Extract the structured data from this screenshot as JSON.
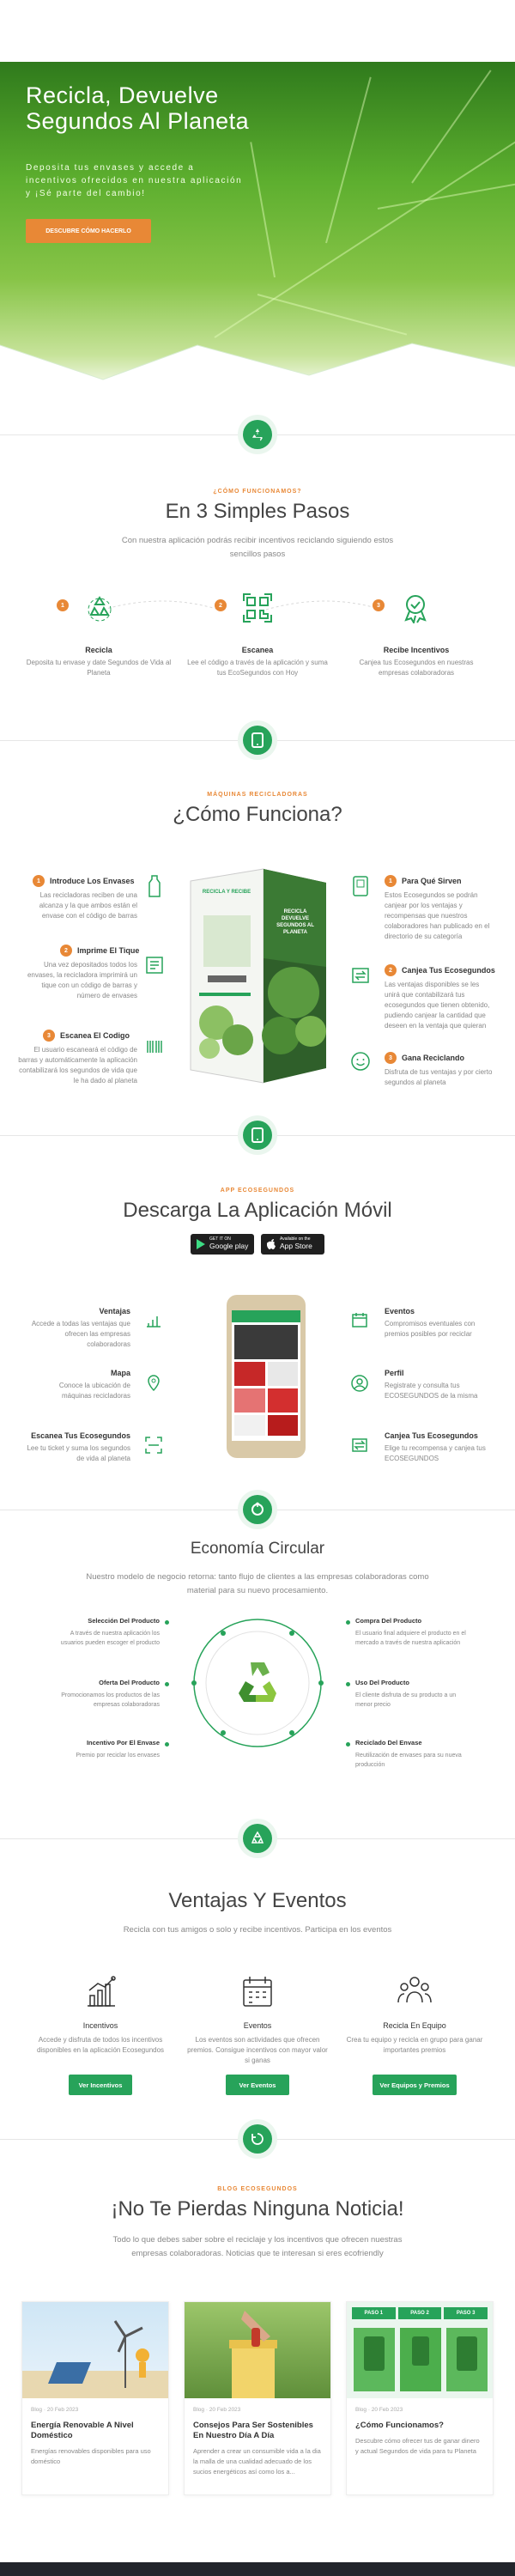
{
  "hero": {
    "title": "Recicla, Devuelve Segundos Al Planeta",
    "text": "Deposita tus envases y accede a incentivos ofrecidos en nuestra aplicación y ¡Sé parte del cambio!",
    "button": "DESCUBRE CÓMO HACERLO"
  },
  "steps": {
    "kicker": "¿CÓMO FUNCIONAMOS?",
    "title": "En 3 Simples Pasos",
    "lead": "Con nuestra aplicación podrás recibir incentivos reciclando siguiendo estos sencillos pasos",
    "items": [
      {
        "num": "1",
        "title": "Recicla",
        "text": "Deposita tu envase y date Segundos de Vida al Planeta",
        "icon": "recycle-icon"
      },
      {
        "num": "2",
        "title": "Escanea",
        "text": "Lee el código a través de la aplicación y suma tus EcoSegundos con Hoy",
        "icon": "qr-scan-icon"
      },
      {
        "num": "3",
        "title": "Recibe Incentivos",
        "text": "Canjea tus Ecosegundos en nuestras empresas colaboradoras",
        "icon": "award-icon"
      }
    ]
  },
  "machine": {
    "kicker": "MÁQUINAS RECICLADORAS",
    "title": "¿Cómo Funciona?",
    "left": [
      {
        "num": "1",
        "title": "Introduce Los Envases",
        "text": "Las recicladoras reciben de una alcanza y la que ambos están el envase con el código de barras"
      },
      {
        "num": "2",
        "title": "Imprime El Tique",
        "text": "Una vez depositados todos los envases, la recicladora imprimirá un tique con un código de barras y número de envases"
      },
      {
        "num": "3",
        "title": "Escanea El Codigo",
        "text": "El usuario escaneará el código de barras y automáticamente la aplicación contabilizará los segundos de vida que le ha dado al planeta"
      }
    ],
    "right": [
      {
        "num": "1",
        "title": "Para Qué Sirven",
        "text": "Estos Ecosegundos se podrán canjear por los ventajas y recompensas que nuestros colaboradores han publicado en el directorio de su categoría"
      },
      {
        "num": "2",
        "title": "Canjea Tus Ecosegundos",
        "text": "Las ventajas disponibles se les unirá que contabilizará tus ecosegundos que tienen obtenido, pudiendo canjear la cantidad que deseen en la ventaja que quieran"
      },
      {
        "num": "3",
        "title": "Gana Reciclando",
        "text": "Disfruta de tus ventajas y por cierto segundos al planeta"
      }
    ],
    "machine_label_top": "RECICLA Y RECIBE",
    "machine_label_side": "RECICLA DEVUELVE SEGUNDOS AL PLANETA"
  },
  "app": {
    "kicker": "APP ECOSEGUNDOS",
    "title": "Descarga La Aplicación Móvil",
    "google_small": "GET IT ON",
    "google": "Google play",
    "apple_small": "Available on the",
    "apple": "App Store",
    "left": [
      {
        "title": "Ventajas",
        "text": "Accede a todas las ventajas que ofrecen las empresas colaboradoras"
      },
      {
        "title": "Mapa",
        "text": "Conoce la ubicación de máquinas recicladoras"
      },
      {
        "title": "Escanea Tus Ecosegundos",
        "text": "Lee tu ticket y suma los segundos de vida al planeta"
      }
    ],
    "right": [
      {
        "title": "Eventos",
        "text": "Compromisos eventuales con premios posibles por reciclar"
      },
      {
        "title": "Perfil",
        "text": "Registrate y consulta tus ECOSEGUNDOS de la misma"
      },
      {
        "title": "Canjea Tus Ecosegundos",
        "text": "Elige tu recompensa y canjea tus ECOSEGUNDOS"
      }
    ]
  },
  "circular": {
    "title": "Economía Circular",
    "lead": "Nuestro modelo de negocio retorna: tanto flujo de clientes a las empresas colaboradoras como material para su nuevo procesamiento.",
    "left": [
      {
        "title": "Selección Del Producto",
        "text": "A través de nuestra aplicación los usuarios pueden escoger el producto"
      },
      {
        "title": "Oferta Del Producto",
        "text": "Promocionamos los productos de las empresas colaboradoras"
      },
      {
        "title": "Incentivo Por El Envase",
        "text": "Premio por reciclar los envases"
      }
    ],
    "right": [
      {
        "title": "Compra Del Producto",
        "text": "El usuario final adquiere el producto en el mercado a través de nuestra aplicación"
      },
      {
        "title": "Uso Del Producto",
        "text": "El cliente disfruta de su producto a un menor precio"
      },
      {
        "title": "Reciclado Del Envase",
        "text": "Reutilización de envases para su nueva producción"
      }
    ]
  },
  "advantages": {
    "title": "Ventajas Y Eventos",
    "lead": "Recicla con tus amigos o solo y recibe incentivos. Participa en los eventos",
    "items": [
      {
        "title": "Incentivos",
        "text": "Accede y disfruta de todos los incentivos disponibles en la aplicación Ecosegundos",
        "button": "Ver Incentivos",
        "icon": "bar-chart-icon"
      },
      {
        "title": "Eventos",
        "text": "Los eventos son actividades que ofrecen premios. Consigue incentivos con mayor valor si ganas",
        "button": "Ver Eventos",
        "icon": "calendar-icon"
      },
      {
        "title": "Recicla En Equipo",
        "text": "Crea tu equipo y recicla en grupo para ganar importantes premios",
        "button": "Ver Equipos y Premios",
        "icon": "team-icon"
      }
    ]
  },
  "blog": {
    "kicker": "BLOG ECOSEGUNDOS",
    "title": "¡No Te Pierdas Ninguna Noticia!",
    "lead": "Todo lo que debes saber sobre el reciclaje y los incentivos que ofrecen nuestras empresas colaboradoras. Noticias que te interesan si eres ecofriendly",
    "posts": [
      {
        "meta": "Blog · 20 Feb 2023",
        "title": "Energía Renovable A Nivel Doméstico",
        "text": "Energías renovables disponibles para uso doméstico"
      },
      {
        "meta": "Blog · 20 Feb 2023",
        "title": "Consejos Para Ser Sostenibles En Nuestro Día A Día",
        "text": "Aprender a crear un consumible vida a la dia la malla de una cualidad adecuado de los sucios energéticos así como los a..."
      },
      {
        "meta": "Blog · 20 Feb 2023",
        "title": "¿Cómo Funcionamos?",
        "text": "Descubre cómo ofrecer tus de ganar dinero y actual Segundos de vida para tu Planeta"
      }
    ],
    "steps_card": [
      "PASO 1",
      "PASO 2",
      "PASO 3"
    ]
  },
  "colors": {
    "green": "#27a35a",
    "orange": "#e88836",
    "text": "#555555"
  }
}
